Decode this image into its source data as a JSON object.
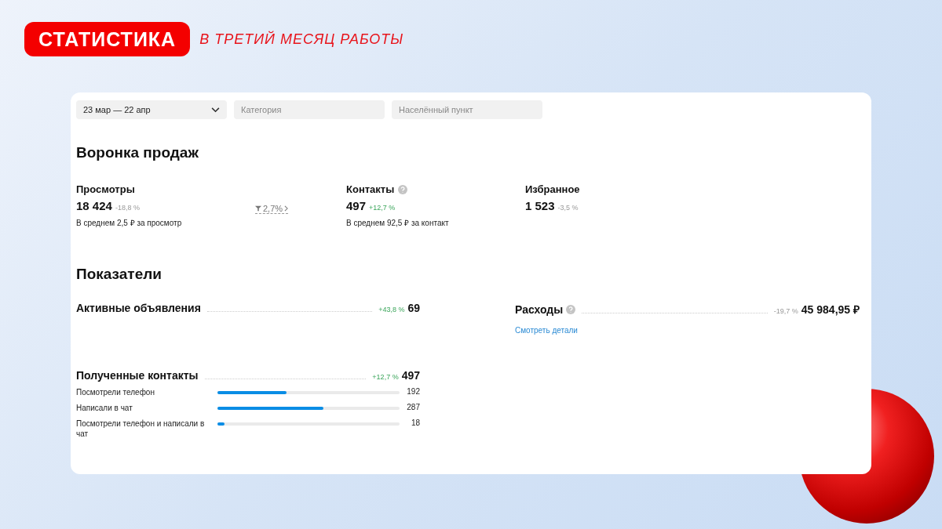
{
  "header": {
    "badge": "СТАТИСТИКА",
    "subtitle": "В ТРЕТИЙ МЕСЯЦ РАБОТЫ"
  },
  "filters": {
    "period": "23 мар — 22 апр",
    "category_placeholder": "Категория",
    "city_placeholder": "Населённый пункт"
  },
  "funnel": {
    "title": "Воронка продаж",
    "conversion": "2,7%",
    "stages": [
      {
        "label": "Просмотры",
        "value": "18 424",
        "change": "-18,8 %",
        "positive": false,
        "help": false,
        "note": "В среднем 2,5 ₽ за просмотр"
      },
      {
        "label": "Контакты",
        "value": "497",
        "change": "+12,7 %",
        "positive": true,
        "help": true,
        "note": "В среднем 92,5 ₽ за контакт"
      },
      {
        "label": "Избранное",
        "value": "1 523",
        "change": "-3,5 %",
        "positive": false,
        "help": false
      }
    ]
  },
  "indicators": {
    "title": "Показатели",
    "active_ads": {
      "label": "Активные объявления",
      "change": "+43,8 %",
      "positive": true,
      "value": "69",
      "help": false
    },
    "expenses": {
      "label": "Расходы",
      "change": "-19,7 %",
      "positive": false,
      "value": "45 984,95 ₽",
      "help": true,
      "link": "Смотреть детали"
    },
    "contacts": {
      "label": "Полученные контакты",
      "change": "+12,7 %",
      "positive": true,
      "value": "497",
      "help": false,
      "breakdown": [
        {
          "label": "Посмотрели телефон",
          "level": 0.38,
          "value": "192"
        },
        {
          "label": "Написали в чат",
          "level": 0.58,
          "value": "287"
        },
        {
          "label": "Посмотрели телефон и написали в чат",
          "level": 0.04,
          "value": "18"
        }
      ]
    }
  }
}
